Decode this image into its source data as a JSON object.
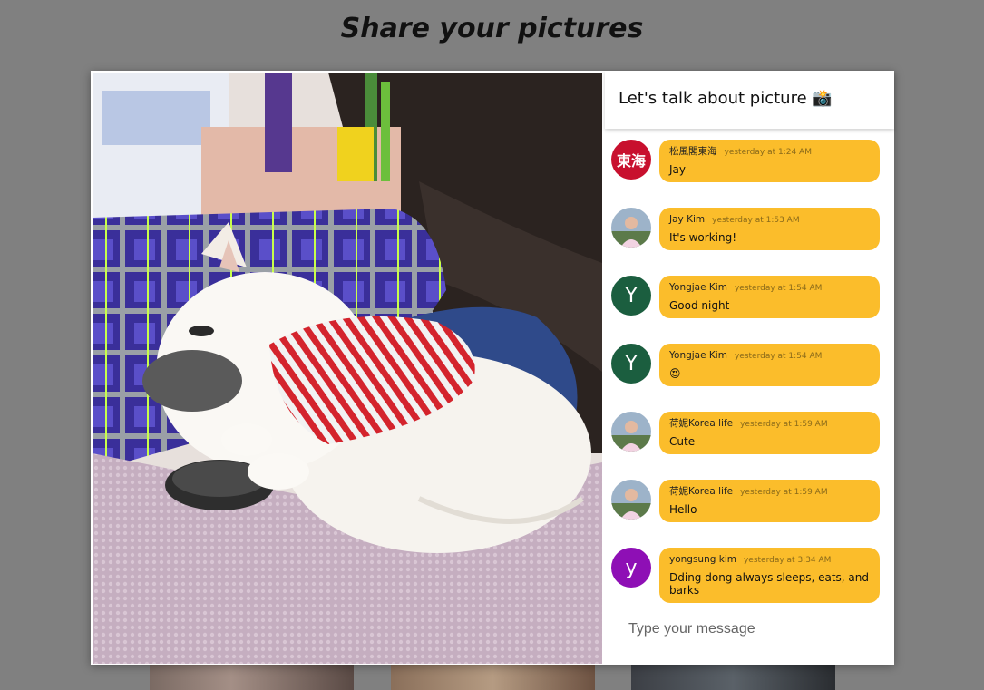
{
  "page": {
    "title": "Share your pictures"
  },
  "chat": {
    "title": "Let's talk about picture 📸",
    "input_placeholder": "Type your message",
    "messages": [
      {
        "author": "松風閣東海",
        "time": "yesterday at 1:24 AM",
        "text": "Jay",
        "avatar": {
          "type": "logo",
          "label": "東海",
          "color": "#c8102e"
        }
      },
      {
        "author": "Jay Kim",
        "time": "yesterday at 1:53 AM",
        "text": "It's working!",
        "avatar": {
          "type": "photo"
        }
      },
      {
        "author": "Yongjae Kim",
        "time": "yesterday at 1:54 AM",
        "text": "Good night",
        "avatar": {
          "type": "letter",
          "label": "Y",
          "color": "#1b5e3f"
        }
      },
      {
        "author": "Yongjae Kim",
        "time": "yesterday at 1:54 AM",
        "text": "😍",
        "avatar": {
          "type": "letter",
          "label": "Y",
          "color": "#1b5e3f"
        }
      },
      {
        "author": "荷妮Korea life",
        "time": "yesterday at 1:59 AM",
        "text": "Cute",
        "avatar": {
          "type": "photo"
        }
      },
      {
        "author": "荷妮Korea life",
        "time": "yesterday at 1:59 AM",
        "text": "Hello",
        "avatar": {
          "type": "photo"
        }
      },
      {
        "author": "yongsung kim",
        "time": "yesterday at 3:34 AM",
        "text": "Dding dong always sleeps, eats, and barks",
        "avatar": {
          "type": "letter",
          "label": "y",
          "color": "#8e0fb5"
        }
      }
    ]
  },
  "colors": {
    "bubble": "#fbbd2b",
    "background": "#808080"
  }
}
